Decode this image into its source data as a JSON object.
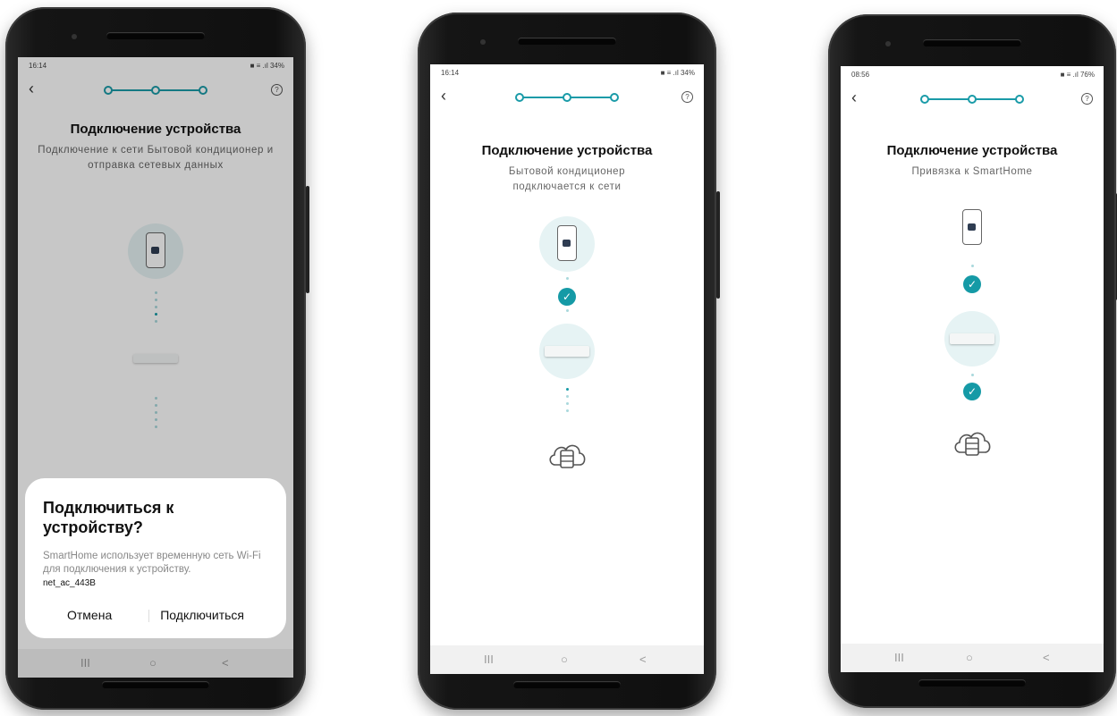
{
  "accent_color": "#1a9ba8",
  "screens": [
    {
      "time": "16:14",
      "status_icons": "■ ≡ .ıl 34%",
      "title": "Подключение устройства",
      "subtitle": "Подключение к сети Бытовой кондиционер и отправка сетевых данных",
      "dialog": {
        "title": "Подключиться к устройству?",
        "body": "SmartHome использует временную сеть Wi-Fi для подключения к устройству.",
        "network": "net_ac_443B",
        "cancel_label": "Отмена",
        "connect_label": "Подключиться"
      }
    },
    {
      "time": "16:14",
      "status_icons": "■ ≡ .ıl 34%",
      "title": "Подключение устройства",
      "subtitle": "Бытовой кондиционер подключается к сети"
    },
    {
      "time": "08:56",
      "status_icons": "■ ≡ .ıl 76%",
      "title": "Подключение устройства",
      "subtitle": "Привязка к SmartHome"
    }
  ],
  "icons": {
    "back": "back-chevron-icon",
    "help": "help-icon",
    "phone": "smartphone-icon",
    "ac": "air-conditioner-icon",
    "check": "check-icon",
    "cloud": "cloud-server-icon"
  },
  "nav": {
    "recent": "III",
    "home": "○",
    "back": "<"
  }
}
